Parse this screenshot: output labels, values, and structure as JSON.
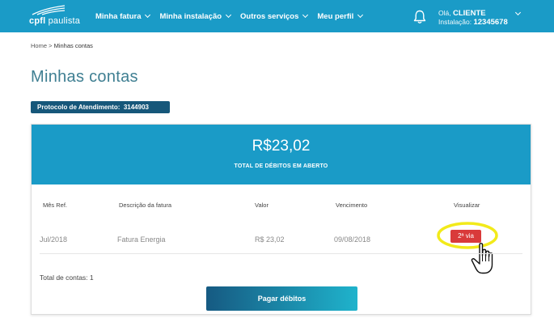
{
  "header": {
    "logo_text_a": "cpfl",
    "logo_text_b": " paulista",
    "nav": [
      {
        "label": "Minha fatura"
      },
      {
        "label": "Minha instalação"
      },
      {
        "label": "Outros serviços"
      },
      {
        "label": "Meu perfil"
      }
    ],
    "greeting": "Olá, ",
    "user_name": "CLIENTE",
    "installation_label": "Instalação: ",
    "installation_number": "12345678"
  },
  "breadcrumb": {
    "home": "Home",
    "separator": " > ",
    "current": "Minhas contas"
  },
  "page_title": "Minhas contas",
  "protocol": {
    "label": "Protocolo de Atendimento:",
    "number": "3144903"
  },
  "summary": {
    "total_value": "R$23,02",
    "total_label": "TOTAL DE DÉBITOS EM ABERTO"
  },
  "table": {
    "columns": [
      "Mês Ref.",
      "Descrição da fatura",
      "Valor",
      "Vencimento",
      "Visualizar"
    ],
    "rows": [
      {
        "month": "Jul/2018",
        "description": "Fatura Energia",
        "value": "R$ 23,02",
        "due_date": "09/08/2018",
        "action": "2ª via"
      }
    ]
  },
  "total_count": "Total de contas: 1",
  "pay_button": "Pagar débitos",
  "colors": {
    "header_bg": "#1a9bc7",
    "protocol_bg": "#16577a",
    "via_button": "#d93a3a",
    "highlight": "#f2ea1a",
    "title_text": "#3f7f92"
  },
  "icons": [
    "cpfl-logo-swoosh",
    "bell-icon",
    "chevron-down-icon",
    "hand-pointer-cursor",
    "highlight-circle"
  ]
}
